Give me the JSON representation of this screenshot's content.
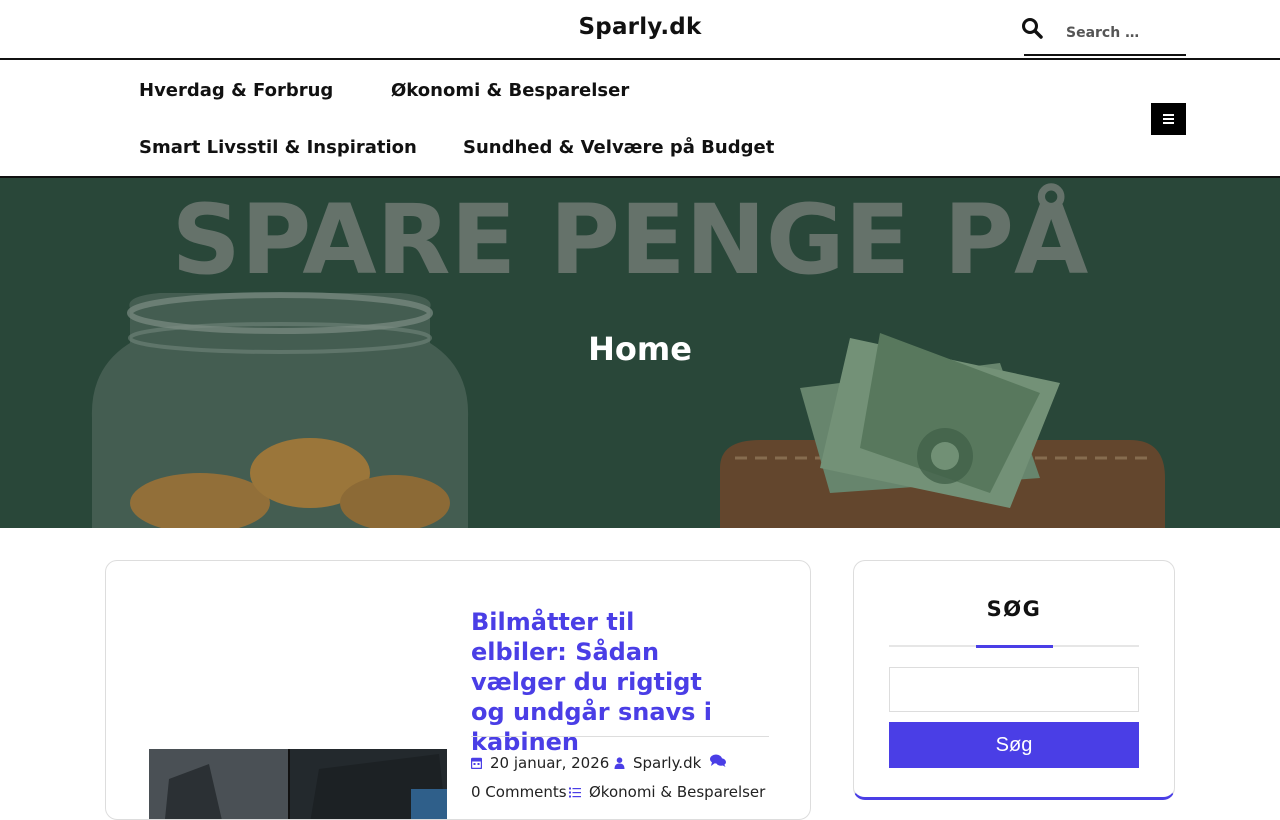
{
  "header": {
    "site_title": "Sparly.dk",
    "search_placeholder": "Search …"
  },
  "nav": {
    "items": [
      {
        "label": "Hverdag & Forbrug"
      },
      {
        "label": "Økonomi & Besparelser"
      },
      {
        "label": "Smart Livsstil & Inspiration"
      },
      {
        "label": "Sundhed & Velvære på Budget"
      }
    ]
  },
  "hero": {
    "title": "Home",
    "image_text": "SPARE PENGE PÅ"
  },
  "post": {
    "title": "Bilmåtter til elbiler: Sådan vælger du rigtigt og undgår snavs i kabinen",
    "date": "20 januar, 2026",
    "author": "Sparly.dk",
    "comments": "0 Comments",
    "category": "Økonomi & Besparelser"
  },
  "sidebar": {
    "search_widget": {
      "title": "SØG",
      "button_label": "Søg"
    }
  },
  "colors": {
    "accent": "#4a3ee6",
    "hero_bg": "#2c4a3c",
    "text": "#111111"
  },
  "icons": {
    "search": "search-icon",
    "menu": "hamburger-icon",
    "date": "calendar-icon",
    "author": "user-icon",
    "comments": "comments-icon",
    "category": "list-icon"
  }
}
